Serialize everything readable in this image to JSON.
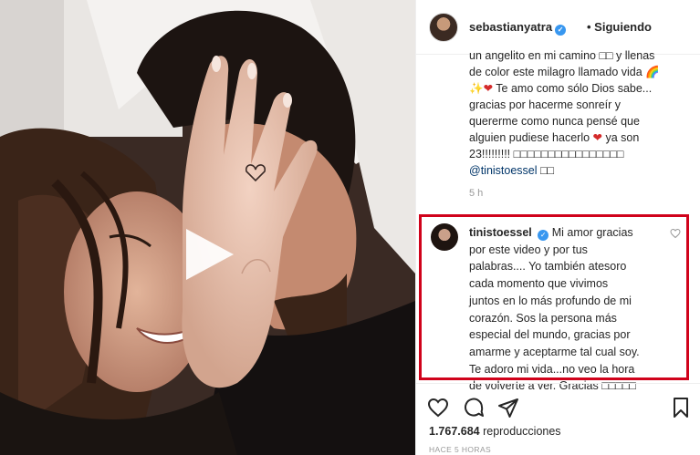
{
  "header": {
    "username": "sebastianyatra",
    "following_label": "• Siguiendo"
  },
  "caption": {
    "lines": [
      "un angelito en mi camino □□ y llenas",
      "de color este milagro llamado vida 🌈",
      "✨",
      " Te amo como sólo Dios sabe...",
      "gracias por hacerme sonreír y",
      "quererme como nunca pensé que",
      "alguien pudiese hacerlo ",
      " ya son",
      "23!!!!!!!!! □□□□□□□□□□□□□□□□",
      "@tinistoessel",
      " □□"
    ],
    "heart": "❤",
    "time": "5 h"
  },
  "comment": {
    "username": "tinistoessel",
    "lines": [
      " Mi amor gracias",
      "por este video y por tus",
      "palabras.... Yo también atesoro",
      "cada momento que vivimos",
      "juntos en lo más profundo de mi",
      "corazón. Sos la persona más",
      "especial del mundo, gracias por",
      "amarme y aceptarme tal cual soy.",
      "Te adoro mi vida...no veo la hora",
      "de volverte a ver. Gracias □□□□□"
    ],
    "highlight_color": "#d0021b"
  },
  "footer": {
    "views_count": "1.767.684",
    "views_label": " reproducciones",
    "time": "HACE 5 HORAS"
  },
  "icons": {
    "play": "play-icon",
    "like": "heart-icon",
    "comment": "comment-icon",
    "share": "share-icon",
    "save": "bookmark-icon",
    "verified": "verified-icon"
  }
}
